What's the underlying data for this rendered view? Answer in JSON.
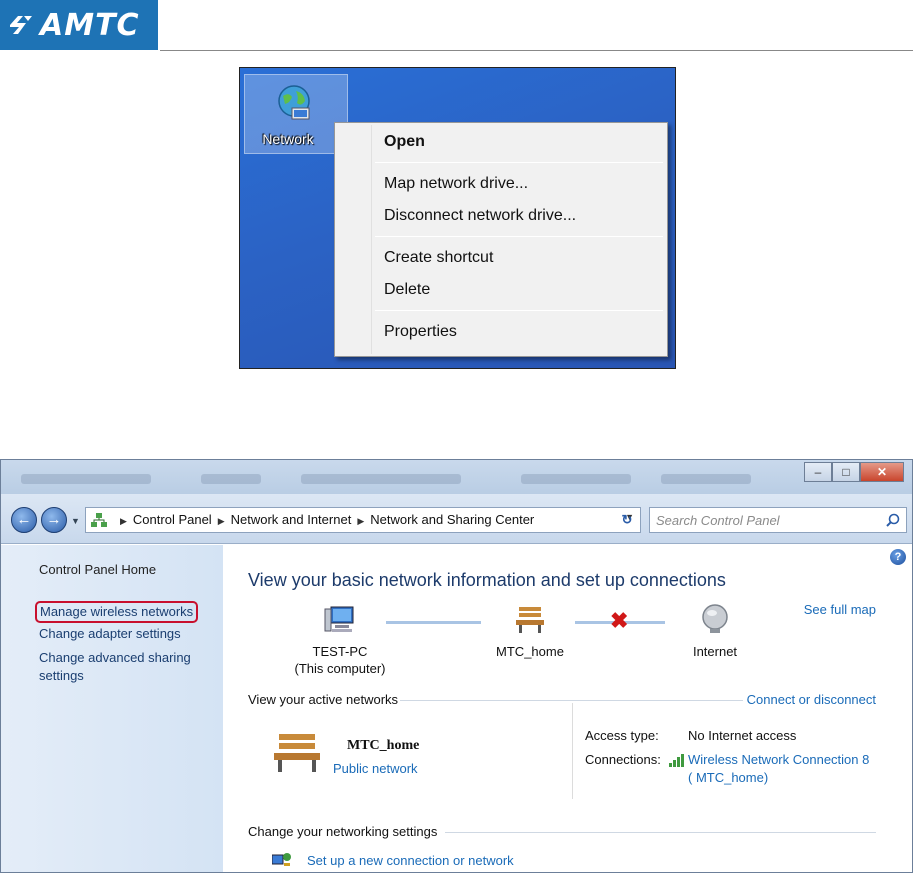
{
  "header": {
    "logo_text": "AMTC"
  },
  "desktop": {
    "icon_label": "Network",
    "context_menu": {
      "items": [
        "Open",
        "Map network drive...",
        "Disconnect network drive...",
        "Create shortcut",
        "Delete",
        "Properties"
      ]
    }
  },
  "window": {
    "address": {
      "crumbs": [
        "Control Panel",
        "Network and Internet",
        "Network and Sharing Center"
      ],
      "search_placeholder": "Search Control Panel"
    },
    "sidebar": {
      "home": "Control Panel Home",
      "links": [
        "Manage wireless networks",
        "Change adapter settings",
        "Change advanced sharing",
        "settings"
      ]
    },
    "main": {
      "heading": "View your basic network information and set up connections",
      "see_full_map": "See full map",
      "map": {
        "computer_name": "TEST-PC",
        "computer_sub": "(This computer)",
        "network_name": "MTC_home",
        "internet": "Internet"
      },
      "active_networks": {
        "label": "View your active networks",
        "connect_link": "Connect or disconnect",
        "network_name": "MTC_home",
        "network_type": "Public network",
        "access_type_label": "Access type:",
        "access_type_value": "No Internet access",
        "connections_label": "Connections:",
        "connection_name": "Wireless Network Connection 8",
        "connection_ssid": "(  MTC_home)"
      },
      "change_settings": {
        "label": "Change your networking settings",
        "setup_link": "Set up a new connection or network"
      }
    }
  }
}
